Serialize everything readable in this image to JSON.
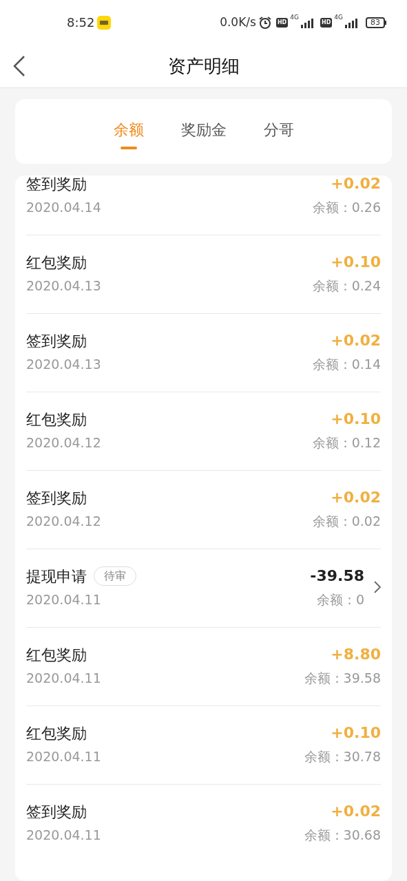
{
  "status_bar": {
    "time": "8:52",
    "net_speed": "0.0K/s",
    "sims": [
      {
        "hd": "HD",
        "network": "4G"
      },
      {
        "hd": "HD",
        "network": "4G"
      }
    ],
    "battery": "83"
  },
  "header": {
    "title": "资产明细"
  },
  "tabs": [
    {
      "label": "余额",
      "selected": true
    },
    {
      "label": "奖励金",
      "selected": false
    },
    {
      "label": "分哥",
      "selected": false
    }
  ],
  "records": [
    {
      "title": "签到奖励",
      "date": "2020.04.14",
      "amount": "+0.02",
      "kind": "income",
      "balance": "余额：0.26",
      "chevron": false
    },
    {
      "title": "红包奖励",
      "date": "2020.04.13",
      "amount": "+0.10",
      "kind": "income",
      "balance": "余额：0.24",
      "chevron": false
    },
    {
      "title": "签到奖励",
      "date": "2020.04.13",
      "amount": "+0.02",
      "kind": "income",
      "balance": "余额：0.14",
      "chevron": false
    },
    {
      "title": "红包奖励",
      "date": "2020.04.12",
      "amount": "+0.10",
      "kind": "income",
      "balance": "余额：0.12",
      "chevron": false
    },
    {
      "title": "签到奖励",
      "date": "2020.04.12",
      "amount": "+0.02",
      "kind": "income",
      "balance": "余额：0.02",
      "chevron": false
    },
    {
      "title": "提现申请",
      "badge": "待审",
      "date": "2020.04.11",
      "amount": "-39.58",
      "kind": "withdrawal",
      "balance": "余额：0",
      "chevron": true
    },
    {
      "title": "红包奖励",
      "date": "2020.04.11",
      "amount": "+8.80",
      "kind": "income",
      "balance": "余额：39.58",
      "chevron": false
    },
    {
      "title": "红包奖励",
      "date": "2020.04.11",
      "amount": "+0.10",
      "kind": "income",
      "balance": "余额：30.78",
      "chevron": false
    },
    {
      "title": "签到奖励",
      "date": "2020.04.11",
      "amount": "+0.02",
      "kind": "income",
      "balance": "余额：30.68",
      "chevron": false
    }
  ]
}
